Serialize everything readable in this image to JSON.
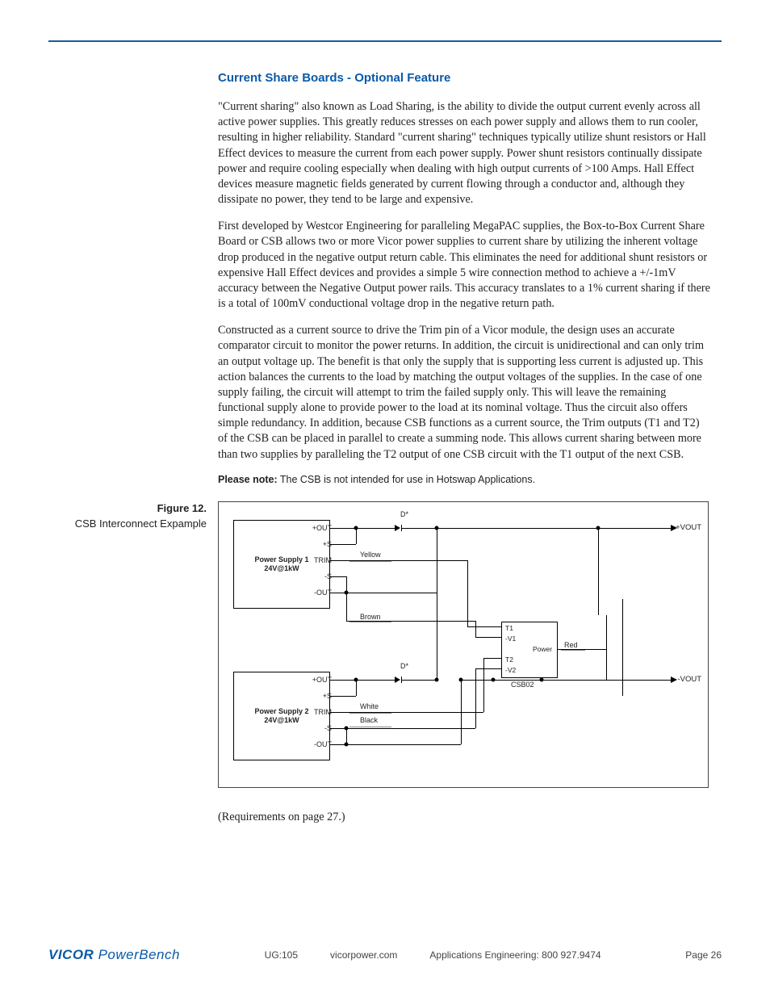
{
  "section": {
    "title": "Current Share Boards  - Optional Feature",
    "p1": "\"Current sharing\" also known as Load Sharing, is the ability to divide the output current evenly across all active power supplies.  This greatly reduces stresses on each power supply and allows them to run cooler, resulting in higher reliability.  Standard \"current sharing\" techniques typically utilize shunt resistors or Hall Effect devices to measure the current from each power supply.  Power shunt resistors continually dissipate power and require cooling especially when dealing with high output currents of >100 Amps.  Hall Effect devices measure magnetic fields generated by current flowing through a conductor and, although they dissipate no power, they tend to be large and expensive.",
    "p2": "First developed by Westcor Engineering for paralleling MegaPAC supplies, the Box-to-Box Current Share Board or CSB allows two or more Vicor power supplies to current share by utilizing the inherent voltage drop produced in the negative output return cable.  This eliminates the need for additional shunt resistors or expensive Hall Effect devices and provides a simple 5 wire connection method to achieve a +/-1mV accuracy between the Negative Output power rails.  This accuracy translates to a 1% current sharing if there is a total of 100mV conductional voltage drop in the negative return path.",
    "p3": "Constructed as a current source to drive the Trim pin of a Vicor module, the design uses an accurate comparator circuit to monitor the power returns.  In addition, the circuit is unidirectional and can only trim an output voltage up.  The benefit is that only the supply that is supporting less current is adjusted up. This action balances the currents to the load by matching the output voltages of the supplies.  In the case of one supply failing, the circuit will attempt to trim the failed supply only.  This will leave the remaining functional supply alone to provide power to the load at its nominal voltage.  Thus the circuit also offers simple redundancy.  In addition, because CSB functions as a current source, the Trim outputs (T1 and T2) of the CSB can be placed in parallel to create a summing node.  This allows current sharing between more than two supplies by paralleling the T2 output of one CSB circuit with the T1 output of the next CSB.",
    "note_label": "Please note:",
    "note_text": " The CSB is not intended for use in Hotswap Applications.",
    "requirements": "(Requirements on page 27.)"
  },
  "figure": {
    "number": "Figure 12.",
    "caption": "CSB Interconnect Expample",
    "ps1_line1": "Power Supply 1",
    "ps1_line2": "24V@1kW",
    "ps2_line1": "Power Supply 2",
    "ps2_line2": "24V@1kW",
    "pins": {
      "p_out": "+OUT",
      "p_s": "+S",
      "trim": "TRIM",
      "n_s": "-S",
      "n_out": "-OUT"
    },
    "csb": {
      "t1": "T1",
      "v1": "-V1",
      "power": "Power",
      "t2": "T2",
      "v2": "-V2",
      "label": "CSB02"
    },
    "wires": {
      "yellow": "Yellow",
      "brown": "Brown",
      "white": "White",
      "black": "Black",
      "red": "Red"
    },
    "d": "D*",
    "vout_p": "+VOUT",
    "vout_n": "-VOUT"
  },
  "footer": {
    "logo1": "VICOR",
    "logo2": " PowerBench",
    "ug": "UG:105",
    "site": "vicorpower.com",
    "appeng": "Applications Engineering: 800 927.9474",
    "page": "Page 26"
  }
}
